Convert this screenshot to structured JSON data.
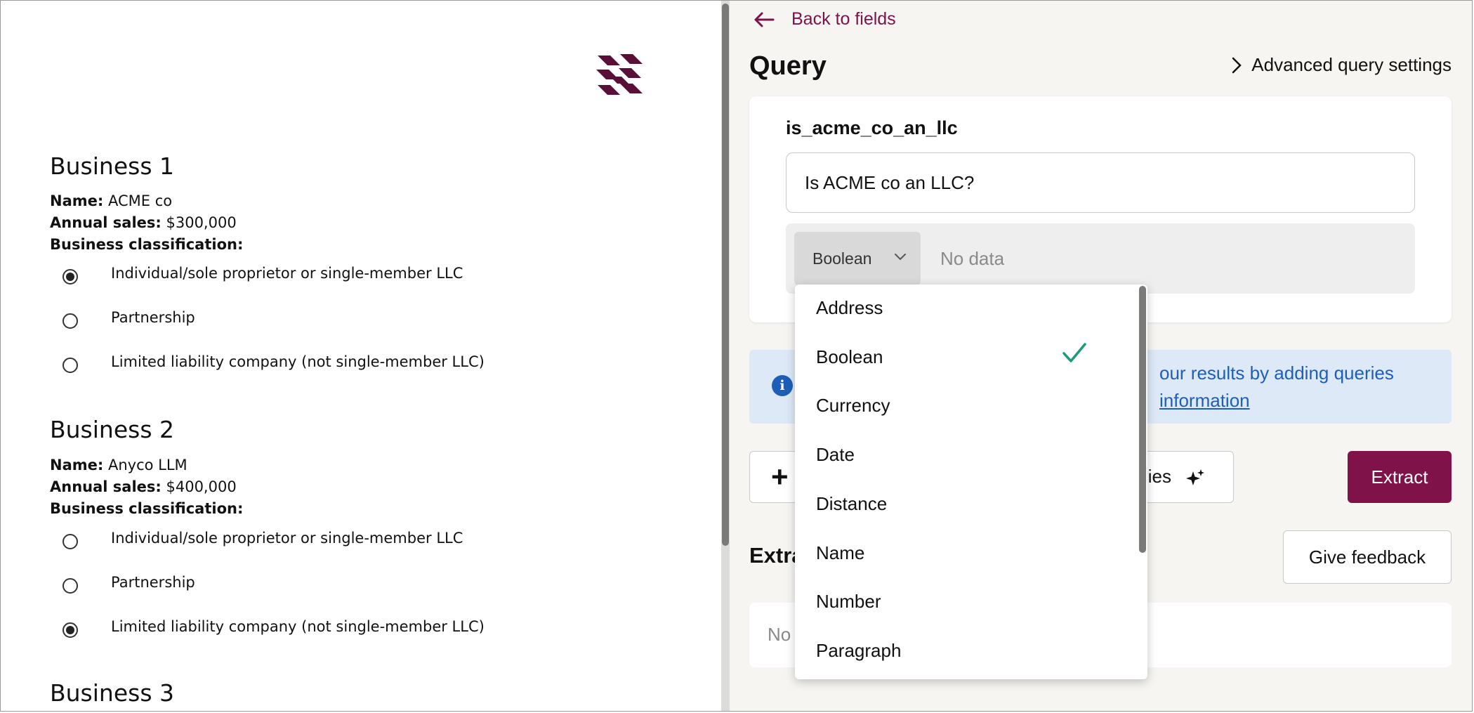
{
  "document": {
    "businesses": [
      {
        "title": "Business 1",
        "name_label": "Name:",
        "name_value": "ACME co",
        "sales_label": "Annual sales:",
        "sales_value": "$300,000",
        "class_label": "Business classification:",
        "options": [
          {
            "label": "Individual/sole proprietor or single-member LLC",
            "checked": true
          },
          {
            "label": "Partnership",
            "checked": false
          },
          {
            "label": "Limited liability company (not single-member LLC)",
            "checked": false
          }
        ]
      },
      {
        "title": "Business 2",
        "name_label": "Name:",
        "name_value": "Anyco LLM",
        "sales_label": "Annual sales:",
        "sales_value": "$400,000",
        "class_label": "Business classification:",
        "options": [
          {
            "label": "Individual/sole proprietor or single-member LLC",
            "checked": false
          },
          {
            "label": "Partnership",
            "checked": false
          },
          {
            "label": "Limited liability company (not single-member LLC)",
            "checked": true
          }
        ]
      },
      {
        "title": "Business 3"
      }
    ]
  },
  "panel": {
    "back_label": "Back to fields",
    "query_title": "Query",
    "advanced_label": "Advanced query settings",
    "query_name": "is_acme_co_an_llc",
    "query_text": "Is ACME co an LLC?",
    "type_selected": "Boolean",
    "no_data": "No data",
    "info_line1": "our results by adding queries",
    "info_line2": "information",
    "add_button_suffix": "ies",
    "extract_label": "Extract",
    "extractions_title": "Extra",
    "feedback_label": "Give feedback",
    "extractions_empty": "No"
  },
  "dropdown": {
    "options": [
      "Address",
      "Boolean",
      "Currency",
      "Date",
      "Distance",
      "Name",
      "Number",
      "Paragraph"
    ],
    "selected": "Boolean",
    "check_color": "#1a9a78"
  },
  "colors": {
    "brand": "#80124a",
    "info_bg": "#dde9f7",
    "info_text": "#1d5fb8"
  }
}
